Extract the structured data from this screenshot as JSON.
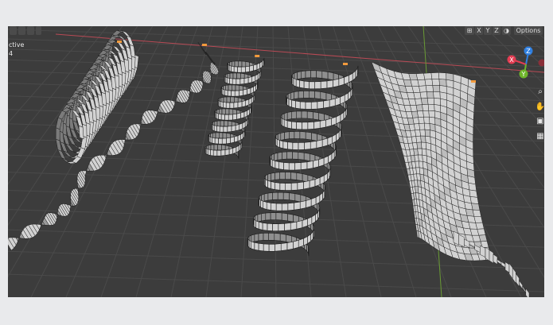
{
  "viewport": {
    "hud": {
      "mode_fragment": "ctive",
      "count_fragment": "4"
    },
    "header": {
      "axis_x": "X",
      "axis_y": "Y",
      "axis_z": "Z",
      "options_label": "Options"
    },
    "gizmo": {
      "x": "X",
      "y": "Y",
      "z": "Z"
    },
    "nav_icons": [
      "zoom-icon",
      "hand-pan-icon",
      "camera-icon",
      "grid-icon"
    ],
    "colors": {
      "background": "#3c3c3c",
      "grid": "#4a4a4a",
      "x_axis": "#b84a55",
      "y_axis": "#6a9b35",
      "gizmo_x": "#e43c52",
      "gizmo_y": "#6eb52a",
      "gizmo_z": "#2f7fe0",
      "mesh_face": "#d2d2d2",
      "mesh_edge": "#1c1c1c",
      "selected_vertex": "#f29a3d"
    }
  }
}
